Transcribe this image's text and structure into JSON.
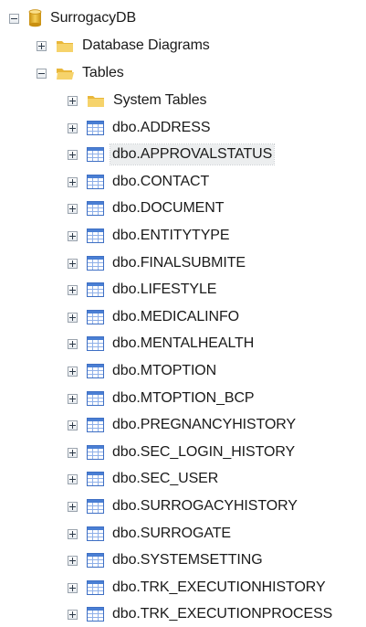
{
  "tree": {
    "root": {
      "label": "SurrogacyDB",
      "expanded": true,
      "icon": "database-icon"
    },
    "folders": [
      {
        "label": "Database Diagrams",
        "expanded": false,
        "icon": "folder-icon"
      },
      {
        "label": "Tables",
        "expanded": true,
        "icon": "folder-open-icon"
      }
    ],
    "table_children": [
      {
        "label": "System Tables",
        "icon": "folder-icon"
      },
      {
        "label": "dbo.ADDRESS",
        "icon": "table-icon"
      },
      {
        "label": "dbo.APPROVALSTATUS",
        "icon": "table-icon",
        "selected": true
      },
      {
        "label": "dbo.CONTACT",
        "icon": "table-icon"
      },
      {
        "label": "dbo.DOCUMENT",
        "icon": "table-icon"
      },
      {
        "label": "dbo.ENTITYTYPE",
        "icon": "table-icon"
      },
      {
        "label": "dbo.FINALSUBMITE",
        "icon": "table-icon"
      },
      {
        "label": "dbo.LIFESTYLE",
        "icon": "table-icon"
      },
      {
        "label": "dbo.MEDICALINFO",
        "icon": "table-icon"
      },
      {
        "label": "dbo.MENTALHEALTH",
        "icon": "table-icon"
      },
      {
        "label": "dbo.MTOPTION",
        "icon": "table-icon"
      },
      {
        "label": "dbo.MTOPTION_BCP",
        "icon": "table-icon"
      },
      {
        "label": "dbo.PREGNANCYHISTORY",
        "icon": "table-icon"
      },
      {
        "label": "dbo.SEC_LOGIN_HISTORY",
        "icon": "table-icon"
      },
      {
        "label": "dbo.SEC_USER",
        "icon": "table-icon"
      },
      {
        "label": "dbo.SURROGACYHISTORY",
        "icon": "table-icon"
      },
      {
        "label": "dbo.SURROGATE",
        "icon": "table-icon"
      },
      {
        "label": "dbo.SYSTEMSETTING",
        "icon": "table-icon"
      },
      {
        "label": "dbo.TRK_EXECUTIONHISTORY",
        "icon": "table-icon"
      },
      {
        "label": "dbo.TRK_EXECUTIONPROCESS",
        "icon": "table-icon"
      }
    ]
  },
  "colors": {
    "folder": "#f2c94c",
    "table_icon": "#4a7fd4",
    "database": "#e6b325",
    "selection": "#eceeef"
  }
}
